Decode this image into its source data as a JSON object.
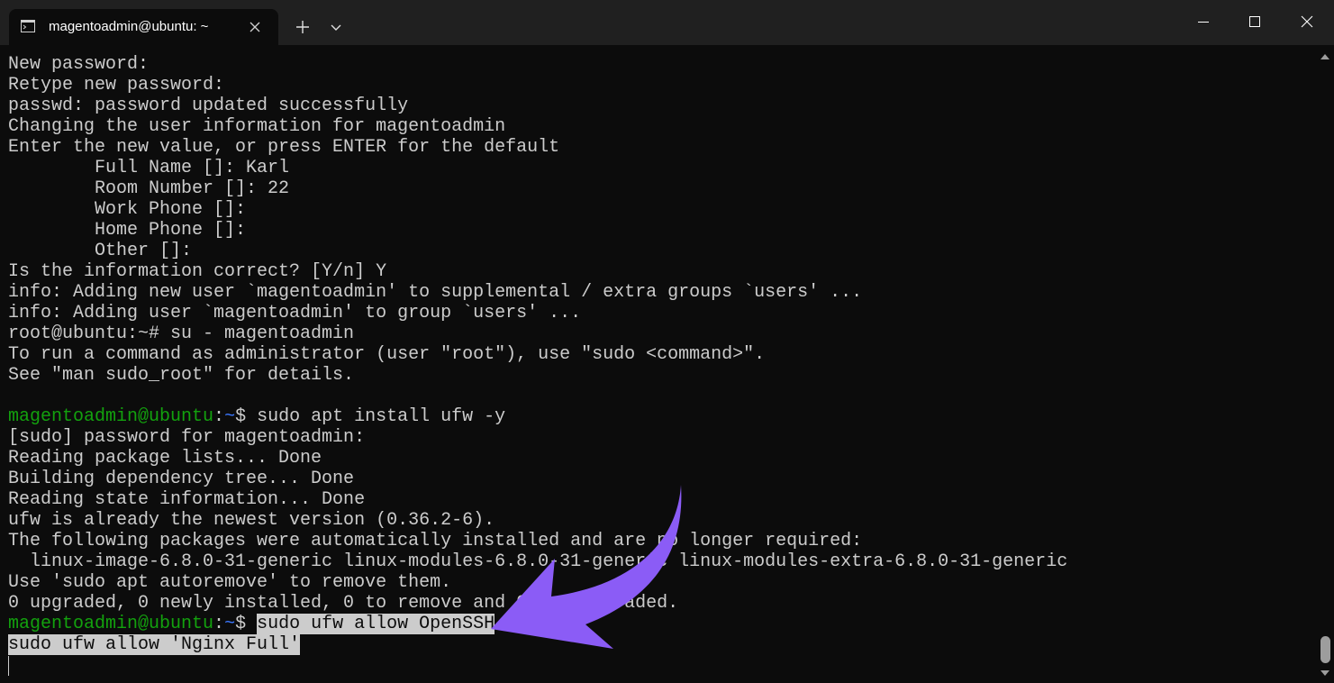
{
  "window": {
    "tab_title": "magentoadmin@ubuntu: ~",
    "icons": {
      "tab": "terminal-icon",
      "tab_close": "close-icon",
      "new_tab": "plus-icon",
      "dropdown": "chevron-down-icon",
      "minimize": "minimize-icon",
      "maximize": "maximize-icon",
      "close": "close-icon"
    }
  },
  "colors": {
    "background": "#0c0c0c",
    "text": "#cccccc",
    "prompt_user": "#13a10e",
    "prompt_path": "#3b78ff",
    "selection": "#cccccc",
    "annotation_arrow": "#8b5cf6"
  },
  "terminal": {
    "lines": [
      "New password:",
      "Retype new password:",
      "passwd: password updated successfully",
      "Changing the user information for magentoadmin",
      "Enter the new value, or press ENTER for the default",
      "        Full Name []: Karl",
      "        Room Number []: 22",
      "        Work Phone []:",
      "        Home Phone []:",
      "        Other []:",
      "Is the information correct? [Y/n] Y",
      "info: Adding new user `magentoadmin' to supplemental / extra groups `users' ...",
      "info: Adding user `magentoadmin' to group `users' ...",
      "root@ubuntu:~# su - magentoadmin",
      "To run a command as administrator (user \"root\"), use \"sudo <command>\".",
      "See \"man sudo_root\" for details.",
      ""
    ],
    "prompt1": {
      "user": "magentoadmin@ubuntu",
      "colon": ":",
      "path": "~",
      "symbol": "$ ",
      "command": "sudo apt install ufw -y"
    },
    "output": [
      "[sudo] password for magentoadmin:",
      "Reading package lists... Done",
      "Building dependency tree... Done",
      "Reading state information... Done",
      "ufw is already the newest version (0.36.2-6).",
      "The following packages were automatically installed and are no longer required:",
      "  linux-image-6.8.0-31-generic linux-modules-6.8.0-31-generic linux-modules-extra-6.8.0-31-generic",
      "Use 'sudo apt autoremove' to remove them.",
      "0 upgraded, 0 newly installed, 0 to remove and 0 not upgraded."
    ],
    "prompt2": {
      "user": "magentoadmin@ubuntu",
      "colon": ":",
      "path": "~",
      "symbol": "$ ",
      "command": "sudo ufw allow OpenSSH"
    },
    "selected_line": "sudo ufw allow 'Nginx Full'"
  }
}
